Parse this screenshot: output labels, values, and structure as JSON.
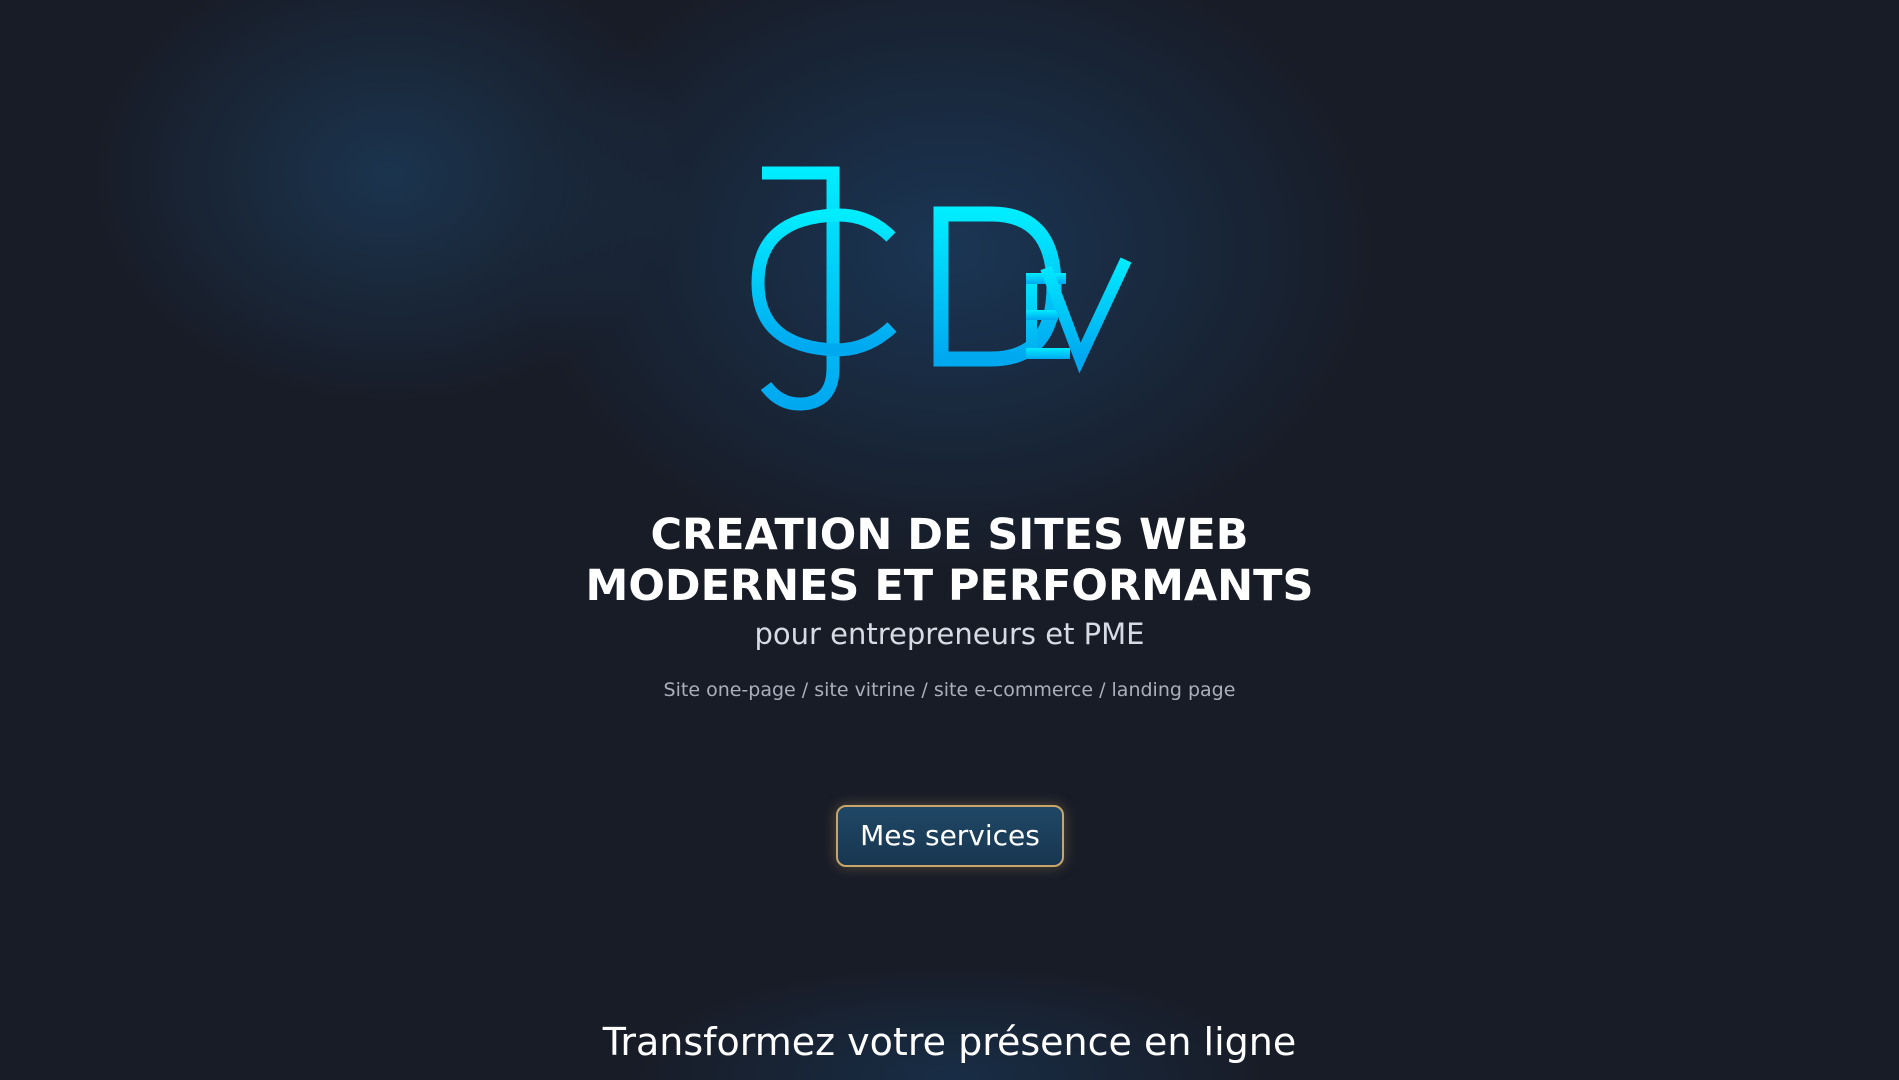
{
  "logo": {
    "text": "JC DEV",
    "colors": {
      "gradient_start": "#00e5ff",
      "gradient_end": "#00a9f0"
    }
  },
  "hero": {
    "headline_line1": "CREATION DE SITES WEB",
    "headline_line2": "MODERNES ET PERFORMANTS",
    "subtitle": "pour entrepreneurs et PME",
    "site_types": "Site one-page / site vitrine / site e-commerce / landing page",
    "cta_label": "Mes services"
  },
  "section": {
    "title": "Transformez votre présence en ligne"
  },
  "colors": {
    "background": "#181c27",
    "glow": "#1a3a5c",
    "accent": "#00d4ff",
    "button_border": "#c9a56a"
  }
}
